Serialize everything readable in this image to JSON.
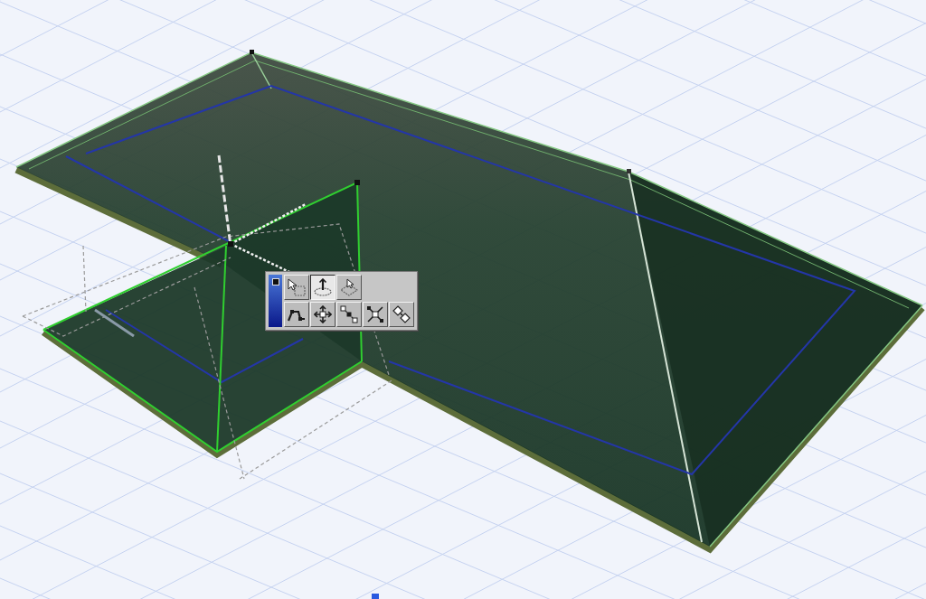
{
  "pet_palette": {
    "rows": [
      {
        "buttons": [
          {
            "kind": "drag",
            "selected": false
          },
          {
            "kind": "lift",
            "selected": true
          },
          {
            "kind": "offset",
            "selected": false
          }
        ]
      },
      {
        "buttons": [
          {
            "kind": "polyline",
            "selected": false
          },
          {
            "kind": "move",
            "selected": false
          },
          {
            "kind": "chain",
            "selected": false
          },
          {
            "kind": "cross",
            "selected": false
          },
          {
            "kind": "pair",
            "selected": false
          }
        ]
      }
    ]
  }
}
